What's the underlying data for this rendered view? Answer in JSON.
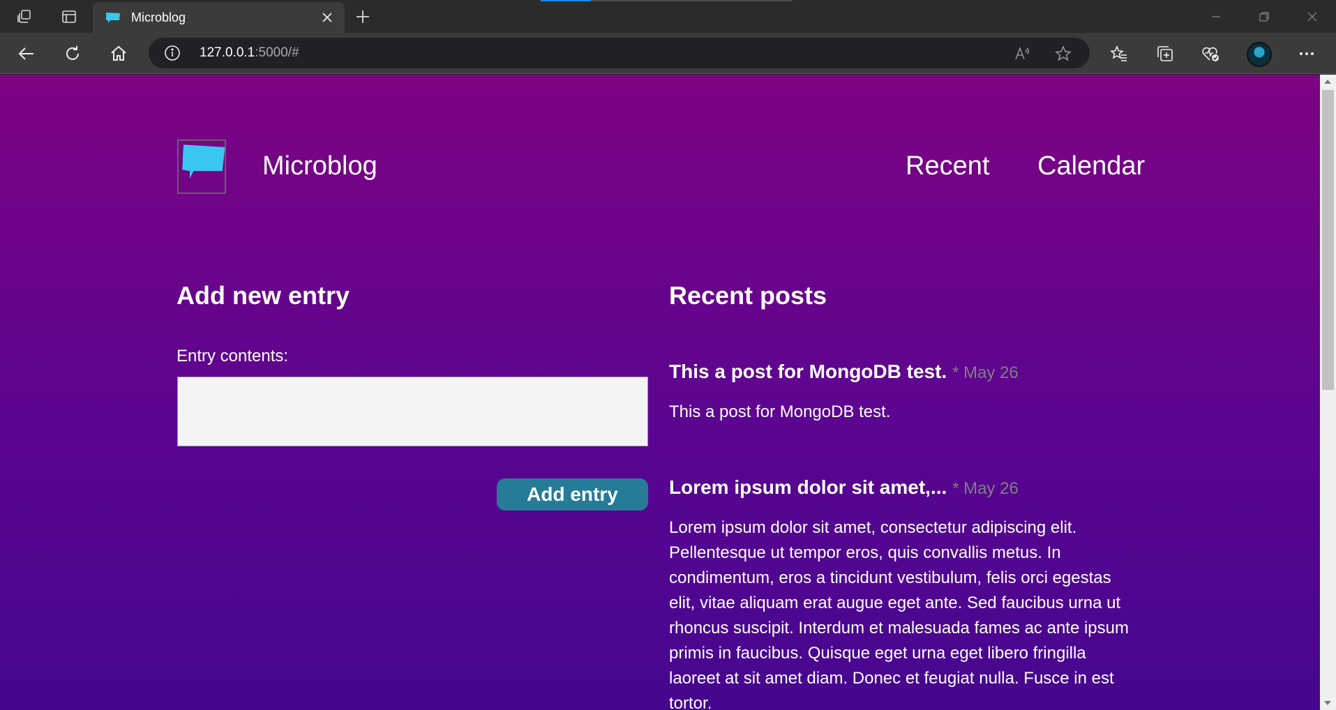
{
  "browser": {
    "tab_title": "Microblog",
    "address_host": "127.0.0.1",
    "address_rest": ":5000/#"
  },
  "site": {
    "title": "Microblog",
    "nav": [
      "Recent",
      "Calendar"
    ]
  },
  "form": {
    "heading": "Add new entry",
    "label": "Entry contents:",
    "textarea_value": "",
    "button": "Add entry"
  },
  "recent": {
    "heading": "Recent posts",
    "posts": [
      {
        "title": "This a post for MongoDB test.",
        "date": "* May 26",
        "body": "This a post for MongoDB test."
      },
      {
        "title": "Lorem ipsum dolor sit amet,...",
        "date": "* May 26",
        "body": "Lorem ipsum dolor sit amet, consectetur adipiscing elit. Pellentesque ut tempor eros, quis convallis metus. In condimentum, eros a tincidunt vestibulum, felis orci egestas elit, vitae aliquam erat augue eget ante. Sed faucibus urna ut rhoncus suscipit. Interdum et malesuada fames ac ante ipsum primis in faucibus. Quisque eget urna eget libero fringilla laoreet at sit amet diam. Donec et feugiat nulla. Fusce in est tortor."
      }
    ]
  },
  "colors": {
    "page_gradient_top": "#7d0382",
    "page_gradient_bottom": "#46068f",
    "button": "#267c96",
    "logo_bubble": "#39c8f0",
    "date_text": "#7f7f7f"
  }
}
